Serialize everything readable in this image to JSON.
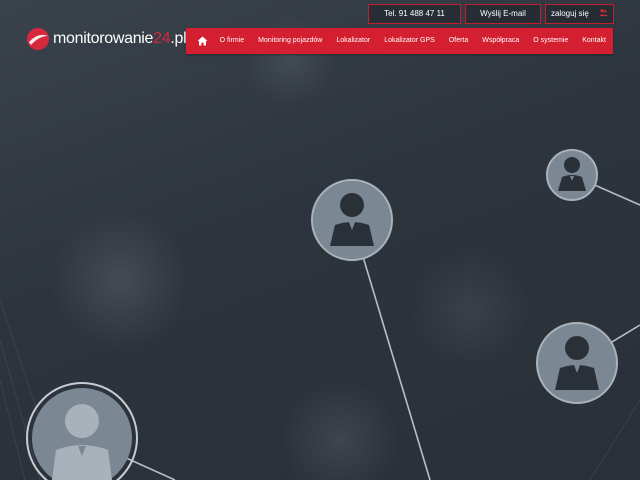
{
  "brand": {
    "name_main": "monitorowanie",
    "name_num": "24",
    "name_tld": ".pl",
    "accent": "#d31f30"
  },
  "topbar": {
    "phone_label": "Tel. 91 488 47 11",
    "email_label": "Wyślij E-mail",
    "login_label": "zaloguj się",
    "login_icon": "users-icon"
  },
  "nav": {
    "home_icon": "home-icon",
    "items": [
      {
        "label": "O firmie"
      },
      {
        "label": "Monitoring pojazdów"
      },
      {
        "label": "Lokalizator"
      },
      {
        "label": "Lokalizator GPS"
      },
      {
        "label": "Oferta"
      },
      {
        "label": "Współpraca"
      },
      {
        "label": "O systemie"
      },
      {
        "label": "Kontakt"
      }
    ]
  },
  "hero": {
    "graphic": "people-network",
    "node_icon": "person-icon"
  }
}
